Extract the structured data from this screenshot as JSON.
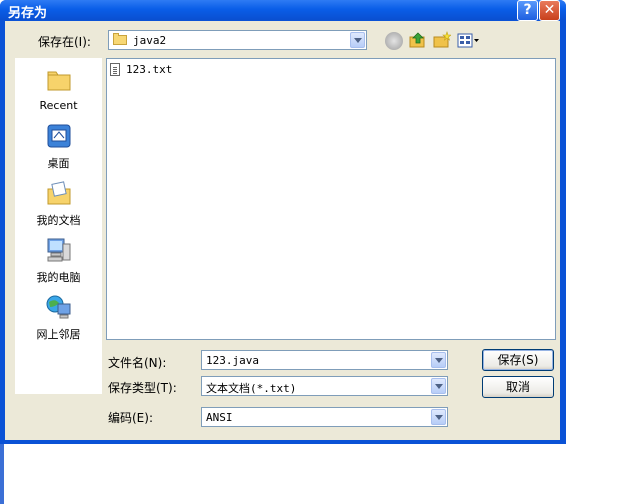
{
  "window": {
    "title": "另存为",
    "help_glyph": "?",
    "close_glyph": "✕"
  },
  "save_in": {
    "label": "保存在(I):",
    "value": "java2"
  },
  "places": [
    {
      "label": "Recent",
      "icon": "recent-folder-icon"
    },
    {
      "label": "桌面",
      "icon": "desktop-icon"
    },
    {
      "label": "我的文档",
      "icon": "my-documents-icon"
    },
    {
      "label": "我的电脑",
      "icon": "my-computer-icon"
    },
    {
      "label": "网上邻居",
      "icon": "network-places-icon"
    }
  ],
  "files": [
    {
      "name": "123.txt",
      "icon": "text-file-icon"
    }
  ],
  "filename": {
    "label": "文件名(N):",
    "value": "123.java"
  },
  "filetype": {
    "label": "保存类型(T):",
    "value": "文本文档(*.txt)"
  },
  "encoding": {
    "label": "编码(E):",
    "value": "ANSI"
  },
  "buttons": {
    "save": "保存(S)",
    "cancel": "取消"
  },
  "colors": {
    "titlebar": "#0a52d6",
    "client": "#ece9d8",
    "border": "#7f9db9"
  }
}
